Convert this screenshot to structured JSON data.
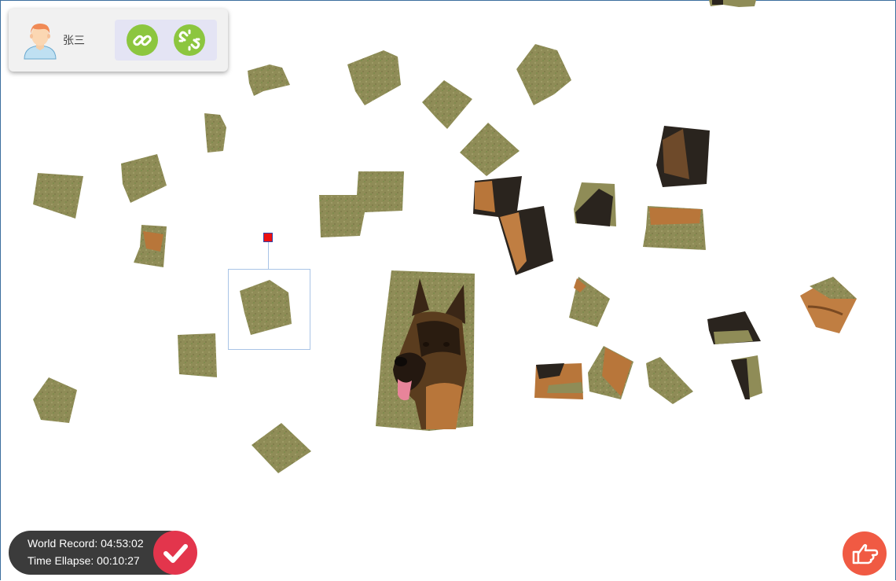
{
  "user": {
    "name": "张三",
    "avatar_icon": "person-avatar-icon"
  },
  "toolbar": {
    "link_icon": "link-icon",
    "unlink_icon": "unlink-icon",
    "accent": "#8cc63f"
  },
  "timer": {
    "world_record": "World Record: 04:53:02",
    "time_elapsed": "Time Ellapse: 00:10:27"
  },
  "actions": {
    "submit_icon": "checkmark-icon",
    "submit_color": "#e3354c",
    "hint_icon": "pointing-hand-icon",
    "hint_color": "#f05a43"
  },
  "puzzle": {
    "subject": "German Shepherd dog on grass",
    "palette": {
      "grass": "#8f8c57",
      "fur_tan": "#b8763a",
      "fur_black": "#2a241e"
    }
  }
}
